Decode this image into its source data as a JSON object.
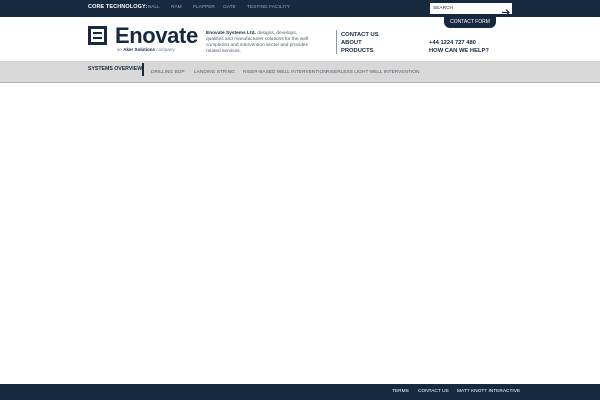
{
  "topbar": {
    "label": "CORE TECHNOLOGY:",
    "links": [
      "BALL",
      "RAM",
      "FLAPPER",
      "GATE",
      "TESTING FACILITY"
    ],
    "search_placeholder": "SEARCH",
    "search_icon": "arrow-right-icon",
    "contact_form": "CONTACT FORM"
  },
  "header": {
    "logo_text": "Enovate",
    "logo_sub_prefix": "an",
    "logo_sub_company": "Aker Solutions",
    "logo_sub_suffix": "company",
    "intro_company": "Enovate Systems Ltd.",
    "intro_text": " designs, develops, qualifies and manufactures solutions for the well completion and intervention sector and provides related services.",
    "quick_links": [
      "CONTACT US",
      "ABOUT",
      "PRODUCTS"
    ],
    "phone": "+44 1224 727 480",
    "help": "HOW CAN WE HELP?"
  },
  "nav": {
    "items": [
      "SYSTEMS OVERVIEW",
      "DRILLING BOP",
      "LANDING STRING",
      "RISER-BASED WELL INTERVENTION",
      "RISERLESS LIGHT WELL INTERVENTION"
    ]
  },
  "footer": {
    "links": [
      "TERMS",
      "CONTACT US",
      "MATT KNOTT INTERACTIVE"
    ]
  },
  "colors": {
    "brand_navy": "#17293e",
    "nav_gray": "#d8d8d8",
    "muted_text": "#4f5d6d"
  }
}
